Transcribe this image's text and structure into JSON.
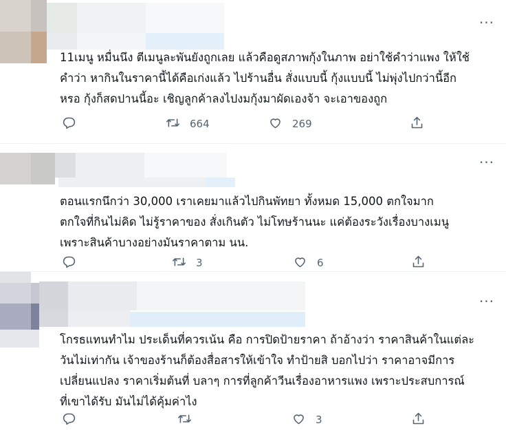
{
  "tweets": [
    {
      "text": "11เมนู หมื่นนึง ตีเมนูละพันยังถูกเลย แล้วคือดูสภาพกุ้งในภาพ อย่าใช้คำว่าแพง ให้ใช้\nคำว่า หากินในราคานี้ได้คือเก่งแล้ว ไปร้านอื่น สั่งแบบนี้ กุ้งแบบนี้ ไม่พุ่งไปกว่านี้อีก\nหรอ กุ้งก็สดปานนี้อะ เชิญลูกค้าลงไปงมกุ้งมาผัดเองจ้า จะเอาของถูก",
      "retweets": "664",
      "likes": "269"
    },
    {
      "text": "ตอนแรกนึกว่า 30,000  เราเคยมาแล้วไปกินพัทยา  ทั้งหมด 15,000 ตกใจมาก\nตกใจที่กินไม่คิด ไม่รู้ราคาของ สั่งเกินตัว ไม่โทษร้านนะ แค่ต้องระวังเรื่องบางเมนู\nเพราะสินค้าบางอย่างมันราคาตาม นน.",
      "retweets": "3",
      "likes": "6"
    },
    {
      "text": "โกรธแทนทำไม ประเด็นที่ควรเน้น คือ การปิดป้ายราคา ถ้าอ้างว่า ราคาสินค้าในแต่ละ\nวันไม่เท่ากัน เจ้าของร้านก็ต้องสื่อสารให้เข้าใจ ทำป้ายสิ บอกไปว่า ราคาอาจมีการ\nเปลี่ยนแปลง ราคาเริ่มต้นที่ บลาๆ การที่ลูกค้าวีนเรื่องอาหารแพง เพราะประสบการณ์\nที่เขาได้รับ มันไม่ได้คุ้มค่าไง",
      "retweets": "",
      "likes": "3"
    }
  ],
  "more_glyph": "···",
  "icons": [
    "reply-icon",
    "retweet-icon",
    "like-icon",
    "share-icon",
    "more-icon"
  ],
  "colors": {
    "icon": "#536471",
    "text": "#0f1419",
    "divider": "#eff3f4"
  }
}
